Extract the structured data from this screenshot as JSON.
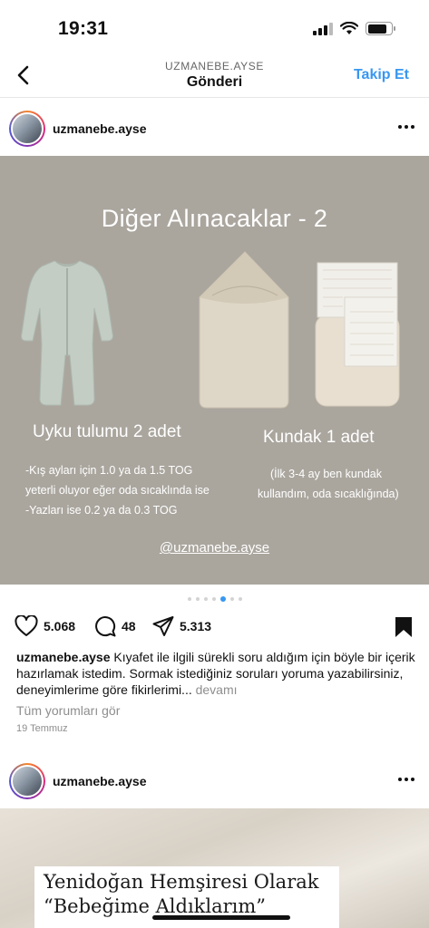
{
  "status": {
    "time": "19:31"
  },
  "nav": {
    "subtitle": "UZMANEBE.AYSE",
    "title": "Gönderi",
    "follow": "Takip Et"
  },
  "post1": {
    "username": "uzmanebe.ayse",
    "slide": {
      "title": "Diğer Alınacaklar - 2",
      "left_label": "Uyku tulumu  2 adet",
      "left_note_1": "-Kış ayları için 1.0 ya da 1.5 TOG",
      "left_note_2": "yeterli oluyor eğer oda sıcaklında ise",
      "left_note_3": "-Yazları ise 0.2 ya da 0.3 TOG",
      "right_label": "Kundak 1 adet",
      "right_note_1": "(İlk 3-4 ay ben kundak",
      "right_note_2": "kullandım, oda sıcaklığında)",
      "handle": "@uzmanebe.ayse"
    },
    "carousel": {
      "total": 7,
      "active": 5
    },
    "likes": "5.068",
    "comments_count": "48",
    "shares": "5.313",
    "caption_user": "uzmanebe.ayse",
    "caption_text": "Kıyafet ile ilgili sürekli soru aldığım için böyle bir içerik hazırlamak istedim. Sormak istediğiniz soruları yoruma yazabilirsiniz, deneyimlerime göre fikirlerimi...",
    "caption_more": "devamı",
    "view_comments": "Tüm yorumları gör",
    "date": "19 Temmuz"
  },
  "post2": {
    "username": "uzmanebe.ayse",
    "image_text_1": "Yenidoğan Hemşiresi Olarak",
    "image_text_2": "“Bebeğime Aldıklarım”"
  },
  "icons": [
    "back-chevron-icon",
    "more-icon",
    "heart-icon",
    "comment-icon",
    "share-icon",
    "bookmark-icon"
  ]
}
